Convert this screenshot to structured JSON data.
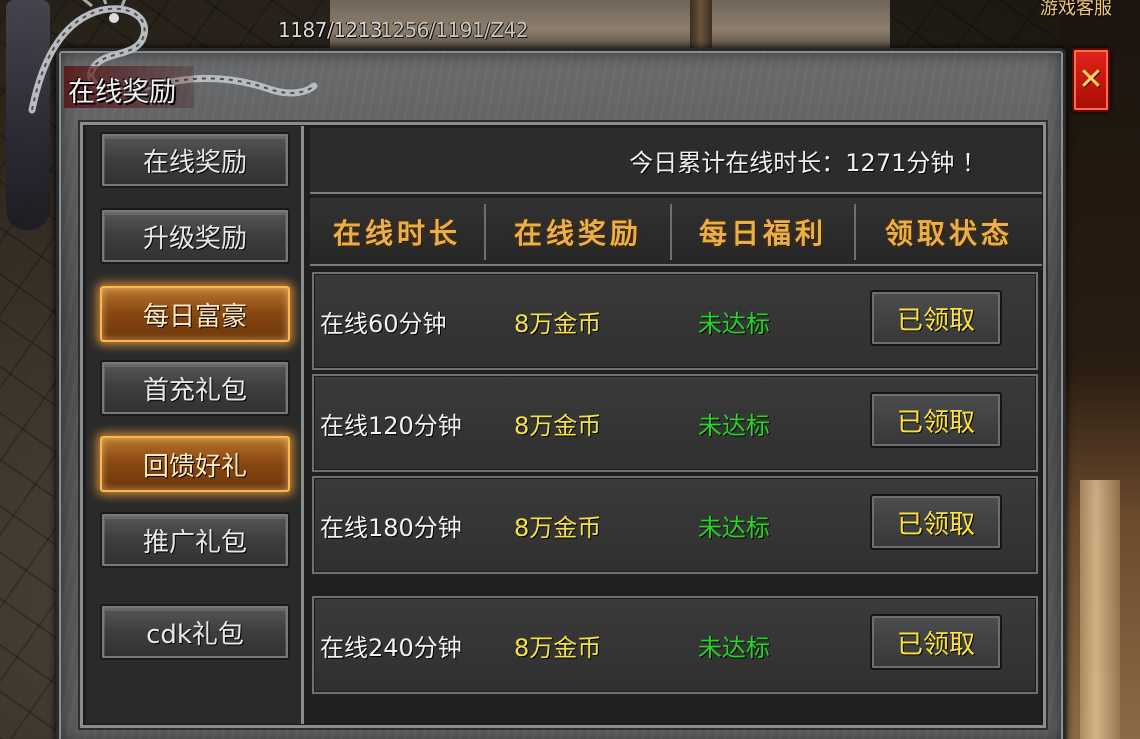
{
  "hud": {
    "coords": "1187/1213",
    "coords_overlap": "1256/1191/Z42",
    "service": "游戏客服"
  },
  "dialog": {
    "title": "在线奖励",
    "close_glyph": "✕"
  },
  "nav": {
    "items": [
      {
        "label": "在线奖励",
        "active": false
      },
      {
        "label": "升级奖励",
        "active": false
      },
      {
        "label": "每日富豪",
        "active": true
      },
      {
        "label": "首充礼包",
        "active": false
      },
      {
        "label": "回馈好礼",
        "active": true
      },
      {
        "label": "推广礼包",
        "active": false
      },
      {
        "label": "cdk礼包",
        "active": false
      }
    ]
  },
  "summary": {
    "text": "今日累计在线时长：1271分钟 ！"
  },
  "table": {
    "headers": [
      "在线时长",
      "在线奖励",
      "每日福利",
      "领取状态"
    ],
    "rows": [
      {
        "time": "在线60分钟",
        "reward": "8万金币",
        "status": "未达标",
        "action": "已领取"
      },
      {
        "time": "在线120分钟",
        "reward": "8万金币",
        "status": "未达标",
        "action": "已领取"
      },
      {
        "time": "在线180分钟",
        "reward": "8万金币",
        "status": "未达标",
        "action": "已领取"
      },
      {
        "time": "在线240分钟",
        "reward": "8万金币",
        "status": "未达标",
        "action": "已领取"
      }
    ]
  },
  "colors": {
    "header_gold": "#e8b04a",
    "reward_yellow": "#f5e14c",
    "status_green": "#27d327",
    "claim_yellow": "#ffe23c",
    "active_glow": "#ffb64c",
    "close_red": "#e02418"
  }
}
